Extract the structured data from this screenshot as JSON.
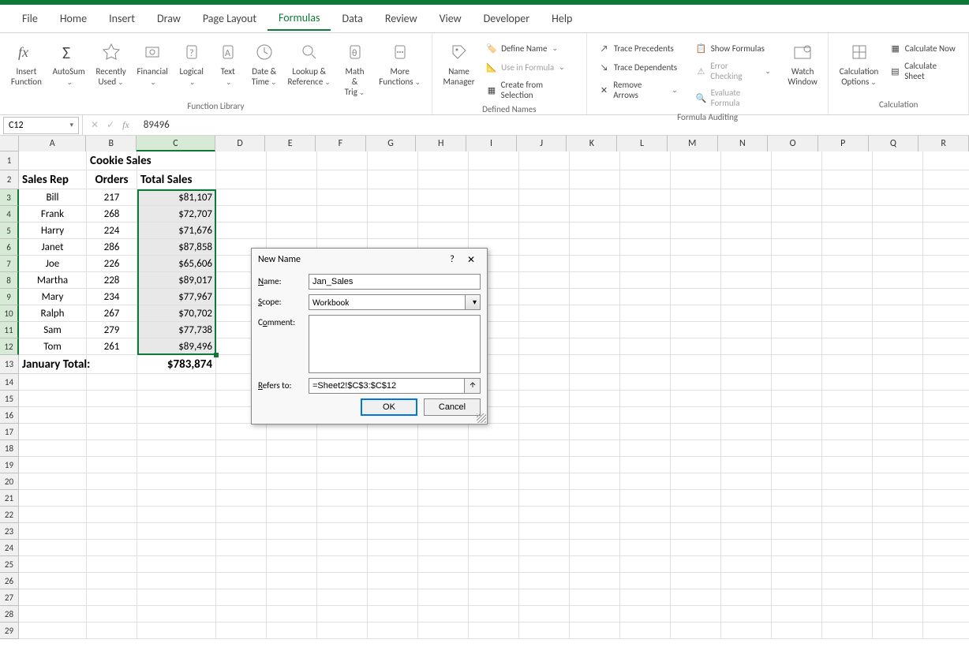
{
  "menu": [
    "File",
    "Home",
    "Insert",
    "Draw",
    "Page Layout",
    "Formulas",
    "Data",
    "Review",
    "View",
    "Developer",
    "Help"
  ],
  "menu_active": 5,
  "ribbon": {
    "func_library": {
      "insert_fn": "Insert\nFunction",
      "autosum": "AutoSum",
      "recent": "Recently\nUsed",
      "financial": "Financial",
      "logical": "Logical",
      "text": "Text",
      "date": "Date &\nTime",
      "lookup": "Lookup &\nReference",
      "math": "Math &\nTrig",
      "more": "More\nFunctions",
      "label": "Function Library"
    },
    "defined_names": {
      "name_mgr": "Name\nManager",
      "define": "Define Name",
      "use": "Use in Formula",
      "create": "Create from Selection",
      "label": "Defined Names"
    },
    "auditing": {
      "trace_prec": "Trace Precedents",
      "trace_dep": "Trace Dependents",
      "remove": "Remove Arrows",
      "show_f": "Show Formulas",
      "err": "Error Checking",
      "eval": "Evaluate Formula",
      "watch": "Watch\nWindow",
      "label": "Formula Auditing"
    },
    "calc": {
      "options": "Calculation\nOptions",
      "now": "Calculate Now",
      "sheet": "Calculate Sheet",
      "label": "Calculation"
    }
  },
  "name_box": "C12",
  "formula_value": "89496",
  "columns": [
    "A",
    "B",
    "C",
    "D",
    "E",
    "F",
    "G",
    "H",
    "I",
    "J",
    "K",
    "L",
    "M",
    "N",
    "O",
    "P",
    "Q",
    "R"
  ],
  "sheet": {
    "title": "Cookie Sales",
    "headers": [
      "Sales Rep",
      "Orders",
      "Total Sales"
    ],
    "rows": [
      {
        "rep": "Bill",
        "orders": "217",
        "total": "$81,107"
      },
      {
        "rep": "Frank",
        "orders": "268",
        "total": "$72,707"
      },
      {
        "rep": "Harry",
        "orders": "224",
        "total": "$71,676"
      },
      {
        "rep": "Janet",
        "orders": "286",
        "total": "$87,858"
      },
      {
        "rep": "Joe",
        "orders": "226",
        "total": "$65,606"
      },
      {
        "rep": "Martha",
        "orders": "228",
        "total": "$89,017"
      },
      {
        "rep": "Mary",
        "orders": "234",
        "total": "$77,967"
      },
      {
        "rep": "Ralph",
        "orders": "267",
        "total": "$70,702"
      },
      {
        "rep": "Sam",
        "orders": "279",
        "total": "$77,738"
      },
      {
        "rep": "Tom",
        "orders": "261",
        "total": "$89,496"
      }
    ],
    "footer_label": "January Total:",
    "footer_total": "$783,874"
  },
  "dialog": {
    "title": "New Name",
    "name_label": "Name:",
    "name_value": "Jan_Sales",
    "scope_label": "Scope:",
    "scope_value": "Workbook",
    "comment_label": "Comment:",
    "comment_value": "",
    "refers_label": "Refers to:",
    "refers_value": "=Sheet2!$C$3:$C$12",
    "ok": "OK",
    "cancel": "Cancel"
  }
}
